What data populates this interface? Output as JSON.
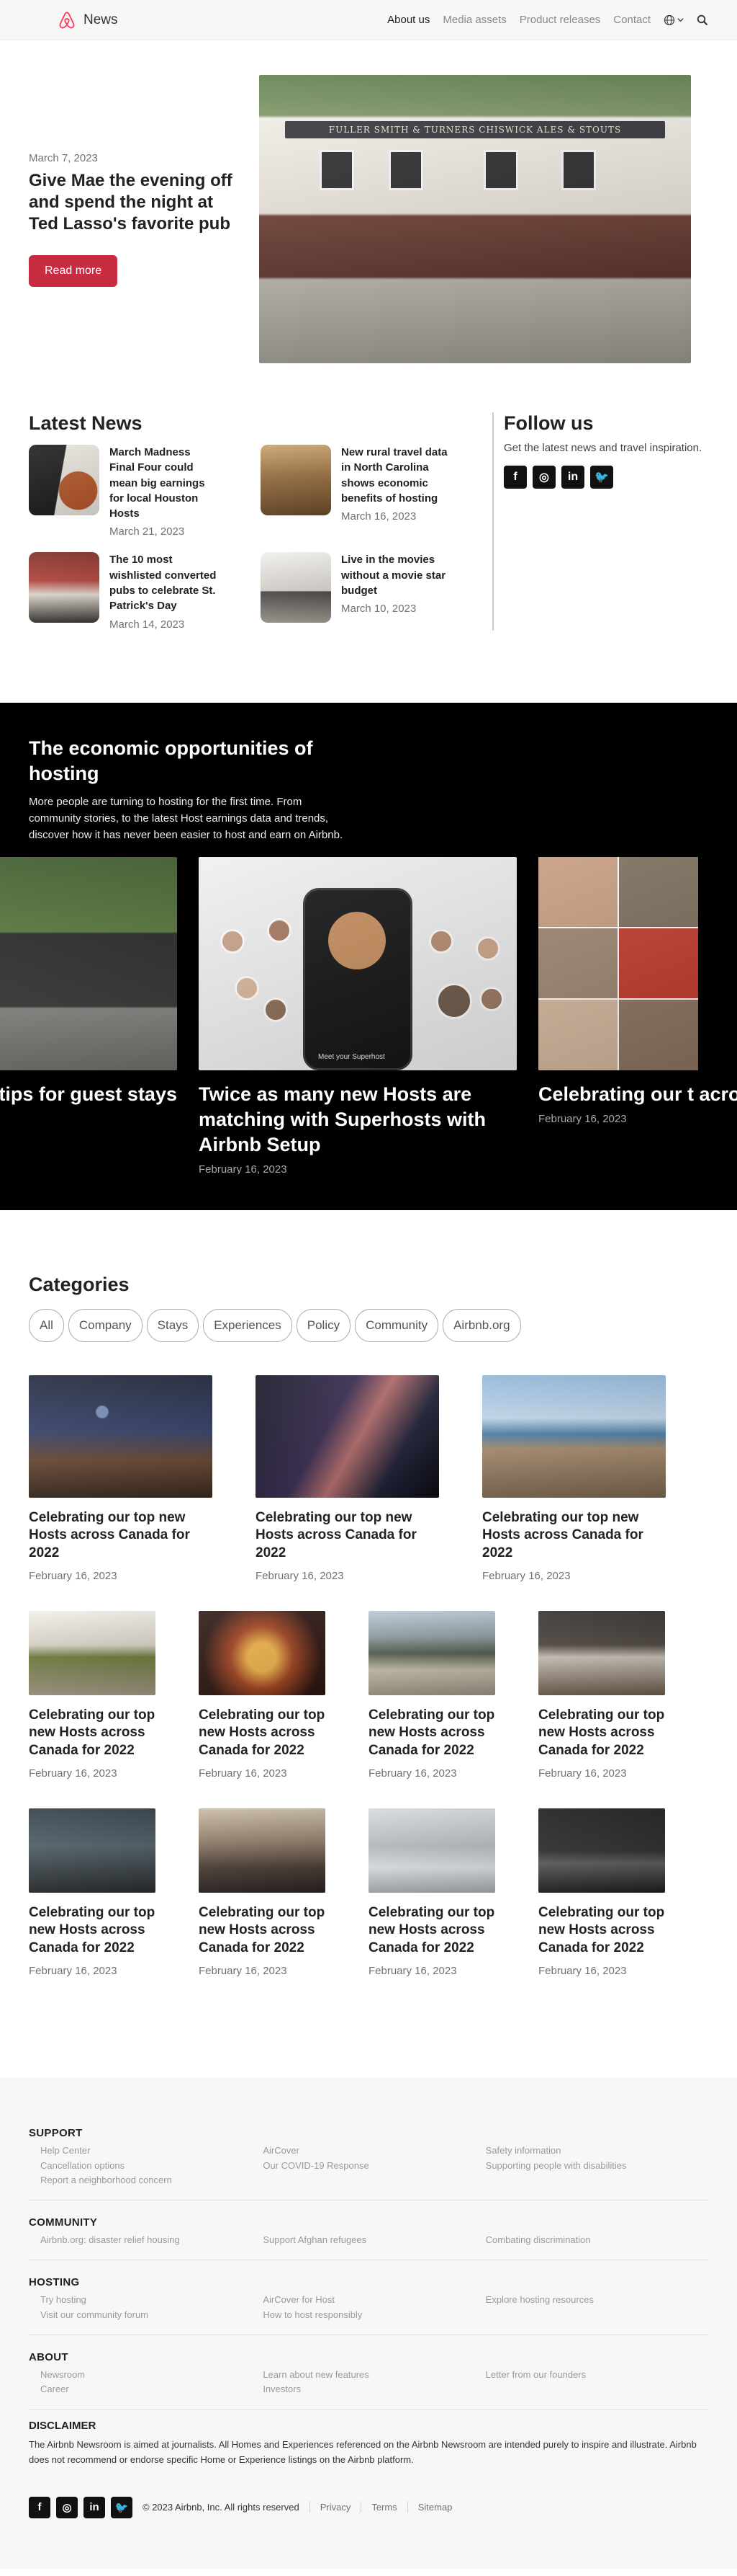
{
  "nav": {
    "brand": "News",
    "links": [
      "About us",
      "Media assets",
      "Product releases",
      "Contact"
    ]
  },
  "hero": {
    "date": "March 7, 2023",
    "title": "Give Mae the evening off and spend the night at Ted Lasso's favorite pub",
    "button": "Read more",
    "image_sign": "FULLER SMITH & TURNERS CHISWICK ALES & STOUTS"
  },
  "latest": {
    "heading": "Latest News",
    "items": [
      {
        "title": "March Madness Final Four could mean big earnings for local Houston Hosts",
        "date": "March 21, 2023"
      },
      {
        "title": "New rural travel data in North Carolina shows economic benefits of hosting",
        "date": "March 16, 2023"
      },
      {
        "title": "The 10 most wishlisted converted pubs to celebrate St. Patrick's Day",
        "date": "March 14, 2023"
      },
      {
        "title": "Live in the movies without a movie star budget",
        "date": "March 10, 2023"
      }
    ]
  },
  "follow": {
    "heading": "Follow us",
    "text": "Get the latest news and travel inspiration.",
    "icons": [
      "facebook-icon",
      "instagram-icon",
      "linkedin-icon",
      "twitter-icon"
    ]
  },
  "economic": {
    "heading": "The economic opportunities of hosting",
    "text": "More people are turning to hosting for the first time. From community stories, to the latest Host earnings data and trends, discover how it has never been easier to host and earn on Airbnb.",
    "cards": [
      {
        "title": "e tips for guest stays",
        "date": ""
      },
      {
        "title": "Twice as many new Hosts are matching with Superhosts with Airbnb Setup",
        "date": "February 16, 2023",
        "phone_caption": "Meet your Superhost"
      },
      {
        "title": "Celebrating our t across Canada fo",
        "date": "February 16, 2023"
      }
    ]
  },
  "categories": {
    "heading": "Categories",
    "chips": [
      "All",
      "Company",
      "Stays",
      "Experiences",
      "Policy",
      "Community",
      "Airbnb.org"
    ],
    "row1": [
      {
        "title": "Celebrating our top new Hosts across Canada for 2022",
        "date": "February 16, 2023"
      },
      {
        "title": "Celebrating our top new Hosts across Canada for 2022",
        "date": "February 16, 2023"
      },
      {
        "title": "Celebrating our top new Hosts across Canada for 2022",
        "date": "February 16, 2023"
      }
    ],
    "row2": [
      {
        "title": "Celebrating our top new Hosts across Canada for 2022",
        "date": "February 16, 2023"
      },
      {
        "title": "Celebrating our top new Hosts across Canada for 2022",
        "date": "February 16, 2023"
      },
      {
        "title": "Celebrating our top new Hosts across Canada for 2022",
        "date": "February 16, 2023"
      },
      {
        "title": "Celebrating our top new Hosts across Canada for 2022",
        "date": "February 16, 2023"
      }
    ],
    "row3": [
      {
        "title": "Celebrating our top new Hosts across Canada for 2022",
        "date": "February 16, 2023"
      },
      {
        "title": "Celebrating our top new Hosts across Canada for 2022",
        "date": "February 16, 2023"
      },
      {
        "title": "Celebrating our top new Hosts across Canada for 2022",
        "date": "February 16, 2023"
      },
      {
        "title": "Celebrating our top new Hosts across Canada for 2022",
        "date": "February 16, 2023"
      }
    ]
  },
  "footer": {
    "support": {
      "heading": "SUPPORT",
      "links": [
        "Help Center",
        "Cancellation options",
        "Report a neighborhood concern",
        "AirCover",
        "Our COVID-19 Response",
        "Safety information",
        "Supporting people with disabilities"
      ]
    },
    "community": {
      "heading": "COMMUNITY",
      "links": [
        "Airbnb.org: disaster relief housing",
        "Support Afghan refugees",
        "Combating discrimination"
      ]
    },
    "hosting": {
      "heading": "HOSTING",
      "links": [
        "Try hosting",
        "Visit our community forum",
        "AirCover for Host",
        "How to host responsibly",
        "Explore hosting resources"
      ]
    },
    "about": {
      "heading": "ABOUT",
      "links": [
        "Newsroom",
        "Career",
        "Learn about new features",
        "Investors",
        "Letter from our founders"
      ]
    },
    "disclaimer": {
      "heading": "DISCLAIMER",
      "text": "The Airbnb Newsroom is aimed at journalists. All Homes and Experiences referenced on the Airbnb Newsroom are intended purely to inspire and illustrate. Airbnb does not recommend or endorse specific Home or Experience listings on the Airbnb platform."
    },
    "copyright": "© 2023 Airbnb, Inc. All rights reserved",
    "legal": [
      "Privacy",
      "Terms",
      "Sitemap"
    ]
  }
}
